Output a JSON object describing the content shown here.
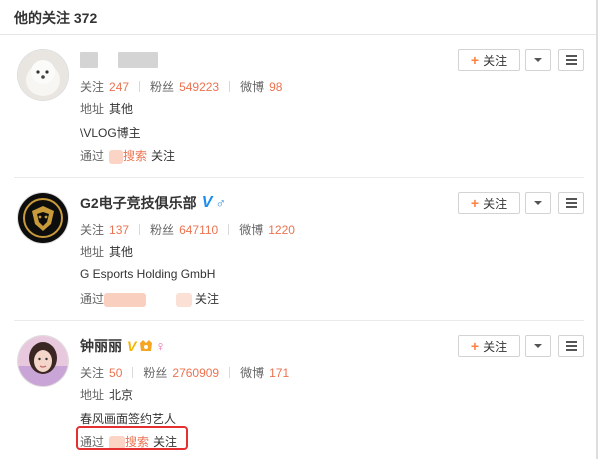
{
  "header": {
    "title": "他的关注 372"
  },
  "labels": {
    "follow": "关注",
    "fans": "粉丝",
    "weibo": "微博",
    "address": "地址",
    "via": "通过",
    "followed": "关注",
    "search": "搜索",
    "add_follow": "关注"
  },
  "colors": {
    "accent": "#eb7350",
    "verified_blue": "#1a8ff0",
    "highlight_border": "#e43030"
  },
  "users": [
    {
      "name": "",
      "following": "247",
      "fans": "549223",
      "weibo": "98",
      "address": "其他",
      "bio": "\\VLOG博主",
      "source_via": "通过",
      "source_channel": "搜索",
      "source_suffix": "关注"
    },
    {
      "name": "G2电子竞技俱乐部",
      "verified": "V",
      "gender_icon": "male-icon",
      "following": "137",
      "fans": "647110",
      "weibo": "1220",
      "address": "其他",
      "bio": "G Esports Holding GmbH",
      "source_via": "通过",
      "source_suffix": "关注"
    },
    {
      "name": "钟丽丽",
      "verified": "V",
      "gender_icon": "female-icon",
      "following": "50",
      "fans": "2760909",
      "weibo": "171",
      "address": "北京",
      "bio": "春风画面签约艺人",
      "source_via": "通过",
      "source_channel": "搜索",
      "source_suffix": "关注"
    }
  ]
}
